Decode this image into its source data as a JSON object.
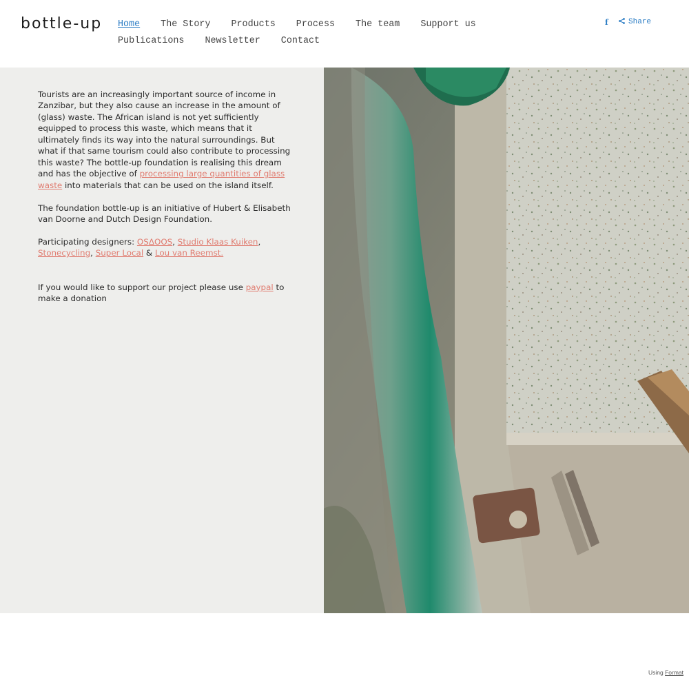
{
  "site": {
    "logo": "bottle-up"
  },
  "nav": {
    "items": [
      "Home",
      "The Story",
      "Products",
      "Process",
      "The team",
      "Support us",
      "Publications",
      "Newsletter",
      "Contact"
    ],
    "active": "Home"
  },
  "social": {
    "facebook_icon": "f",
    "share_label": "Share"
  },
  "content": {
    "intro_before_link": "Tourists are an increasingly important source of income in Zanzibar, but they also cause an increase in the amount of (glass) waste. The African island is not yet sufficiently equipped to process this waste, which means that it ultimately finds its way into the natural surroundings. But what if that same tourism could also contribute to processing this waste? The bottle-up foundation is realising this dream and has the objective of ",
    "intro_link": "processing large quantities of glass waste",
    "intro_after_link": " into materials that can be used on the island itself.",
    "foundation": "The foundation bottle-up is an initiative of Hubert & Elisabeth van Doorne and Dutch Design Foundation.",
    "designers_label": "Participating designers: ",
    "designers": [
      "OSΔOOS",
      "Studio Klaas Kuiken",
      "Stonecycling",
      "Super Local",
      "Lou van Reemst."
    ],
    "designer_separators": [
      ", ",
      ",",
      ", ",
      " & ",
      ""
    ],
    "support_before_link": "If you would like to support our project please use ",
    "support_link": "paypal",
    "support_after_link": " to make a donation"
  },
  "footer": {
    "using_label": "Using",
    "format_link": "Format"
  },
  "colors": {
    "link": "#e07b6f",
    "nav_active": "#2a7cc4",
    "content_bg": "#eeeeec"
  },
  "image": {
    "description_icon": "terrazzo-photo"
  }
}
